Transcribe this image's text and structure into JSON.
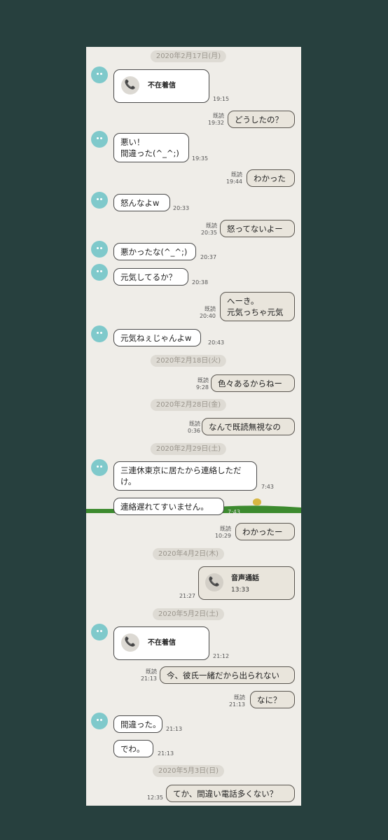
{
  "dates": {
    "d1": "2020年2月17日(月)",
    "d2": "2020年2月18日(火)",
    "d3": "2020年2月28日(金)",
    "d4": "2020年2月29日(土)",
    "d5": "2020年4月2日(木)",
    "d6": "2020年5月2日(土)",
    "d7": "2020年5月3日(日)"
  },
  "read_label": "既読",
  "messages": {
    "m1": {
      "label": "不在着信",
      "time": "19:15"
    },
    "m2": {
      "text": "どうしたの？",
      "time": "19:32"
    },
    "m3": {
      "line1": "悪い！",
      "line2": "間違った(^_^;)",
      "time": "19:35"
    },
    "m4": {
      "text": "わかった",
      "time": "19:44"
    },
    "m5": {
      "text": "怒んなよw",
      "time": "20:33"
    },
    "m6": {
      "text": "怒ってないよー",
      "time": "20:35"
    },
    "m7": {
      "text": "悪かったな(^_^;)",
      "time": "20:37"
    },
    "m8": {
      "text": "元気してるか？",
      "time": "20:38"
    },
    "m9": {
      "line1": "へーき。",
      "line2": "元気っちゃ元気",
      "time": "20:40"
    },
    "m10": {
      "text": "元気ねぇじゃんよw",
      "time": "20:43"
    },
    "m11": {
      "text": "色々あるからねー",
      "time": "9:28"
    },
    "m12": {
      "text": "なんで既読無視なの",
      "time": "0:36"
    },
    "m13": {
      "line1": "三連休東京に居たから連絡しただ",
      "line2": "け。",
      "time": "7:43"
    },
    "m14": {
      "text": "連絡遅れてすいません。",
      "time": "7:43"
    },
    "m15": {
      "text": "わかったー",
      "time": "10:29"
    },
    "m16": {
      "label": "音声通話",
      "duration": "13:33",
      "time": "21:27"
    },
    "m17": {
      "label": "不在着信",
      "time": "21:12"
    },
    "m18": {
      "text": "今、彼氏一緒だから出られない",
      "time": "21:13"
    },
    "m19": {
      "text": "なに？",
      "time": "21:13"
    },
    "m20": {
      "text": "間違った。",
      "time": "21:13"
    },
    "m21": {
      "text": "でわ。",
      "time": "21:13"
    },
    "m22": {
      "text": "てか、間違い電話多くない？",
      "time": "12:35"
    }
  },
  "colors": {
    "background": "#27403e",
    "chat_bg": "#efede8",
    "avatar": "#7fc9cb",
    "grass": "#3c8a2e"
  },
  "icons": {
    "avatar": "avatar-icon",
    "phone": "phone-icon"
  }
}
